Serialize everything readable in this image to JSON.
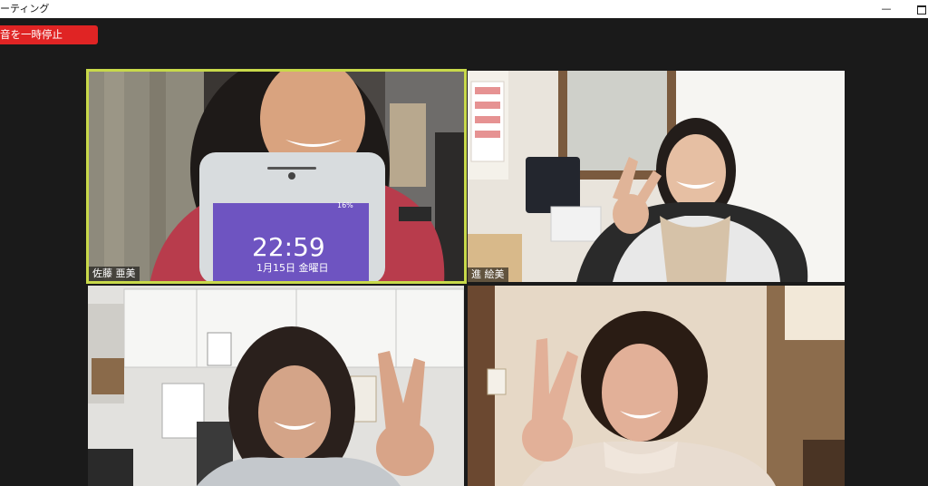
{
  "window": {
    "title": "ーティング",
    "minimize_glyph": "—"
  },
  "toolbar": {
    "pause_recording_label": "音を一時停止"
  },
  "participants": [
    {
      "name": "佐藤 亜美",
      "active_speaker": true
    },
    {
      "name": "進 絵美",
      "active_speaker": false
    },
    {
      "name": "",
      "active_speaker": false
    },
    {
      "name": "",
      "active_speaker": false
    }
  ],
  "phone_screen": {
    "time": "22:59",
    "date": "1月15日 金曜日",
    "battery": "16%"
  },
  "colors": {
    "active_border": "#c8d94a",
    "record_button": "#e02424",
    "background": "#1a1a1a"
  }
}
